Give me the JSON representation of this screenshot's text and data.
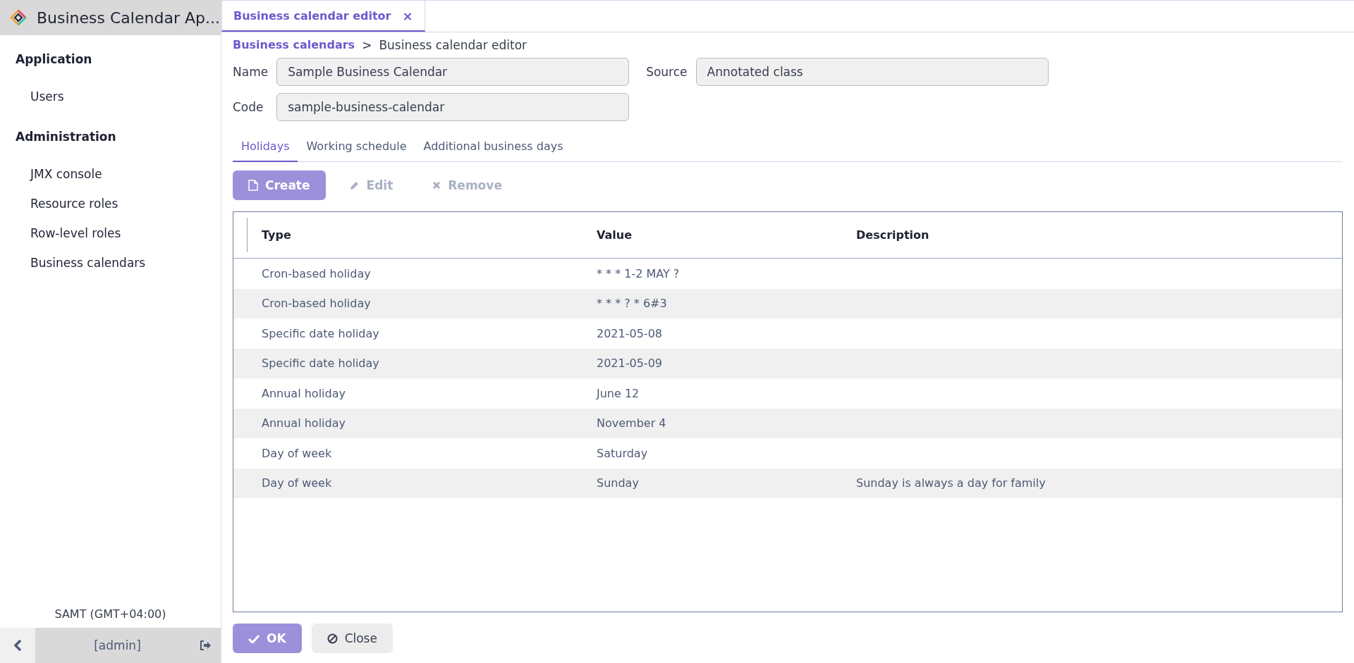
{
  "app": {
    "title": "Business Calendar Ap..."
  },
  "sidebar": {
    "groups": [
      {
        "label": "Application",
        "items": [
          {
            "label": "Users",
            "selected": false
          }
        ]
      },
      {
        "label": "Administration",
        "items": [
          {
            "label": "JMX console",
            "selected": false
          },
          {
            "label": "Resource roles",
            "selected": false
          },
          {
            "label": "Row-level roles",
            "selected": false
          },
          {
            "label": "Business calendars",
            "selected": false
          }
        ]
      }
    ],
    "timezone": "SAMT (GMT+04:00)",
    "user": "[admin]"
  },
  "tabs": [
    {
      "label": "Business calendar editor",
      "selected": true,
      "close": "×"
    }
  ],
  "breadcrumb": {
    "link": "Business calendars",
    "separator": ">",
    "current": "Business calendar editor"
  },
  "form": {
    "fields": [
      {
        "label": "Name",
        "value": "Sample Business Calendar"
      },
      {
        "label": "Source",
        "value": "Annotated class"
      },
      {
        "label": "Code",
        "value": "sample-business-calendar"
      }
    ]
  },
  "subtabs": [
    {
      "label": "Holidays",
      "selected": true
    },
    {
      "label": "Working schedule",
      "selected": false
    },
    {
      "label": "Additional business days",
      "selected": false
    }
  ],
  "toolbar": [
    {
      "kind": "create",
      "label": "Create",
      "disabled": true
    },
    {
      "kind": "edit",
      "label": "Edit",
      "disabled": true
    },
    {
      "kind": "remove",
      "label": "Remove",
      "disabled": true
    }
  ],
  "table": {
    "columns": [
      "Type",
      "Value",
      "Description"
    ],
    "rows": [
      [
        "Cron-based holiday",
        "* * * 1-2 MAY ?",
        ""
      ],
      [
        "Cron-based holiday",
        "* * * ? * 6#3",
        ""
      ],
      [
        "Specific date holiday",
        "2021-05-08",
        ""
      ],
      [
        "Specific date holiday",
        "2021-05-09",
        ""
      ],
      [
        "Annual holiday",
        "June 12",
        ""
      ],
      [
        "Annual holiday",
        "November 4",
        ""
      ],
      [
        "Day of week",
        "Saturday",
        ""
      ],
      [
        "Day of week",
        "Sunday",
        "Sunday is always a day for family"
      ]
    ]
  },
  "buttons": [
    {
      "kind": "ok",
      "label": "OK",
      "disabled": true
    },
    {
      "kind": "close",
      "label": "Close",
      "disabled": false
    }
  ]
}
